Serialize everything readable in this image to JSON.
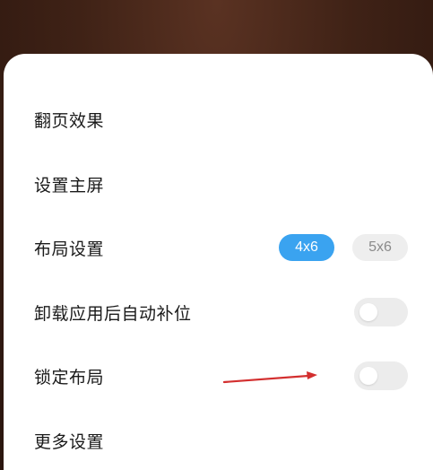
{
  "settings": {
    "rows": [
      {
        "label": "翻页效果"
      },
      {
        "label": "设置主屏"
      },
      {
        "label": "布局设置",
        "options": [
          "4x6",
          "5x6"
        ],
        "selected": "4x6"
      },
      {
        "label": "卸载应用后自动补位",
        "toggle": false
      },
      {
        "label": "锁定布局",
        "toggle": false
      },
      {
        "label": "更多设置"
      }
    ]
  },
  "annotation": {
    "color": "#d32f2f",
    "icon": "red-arrow-icon"
  }
}
